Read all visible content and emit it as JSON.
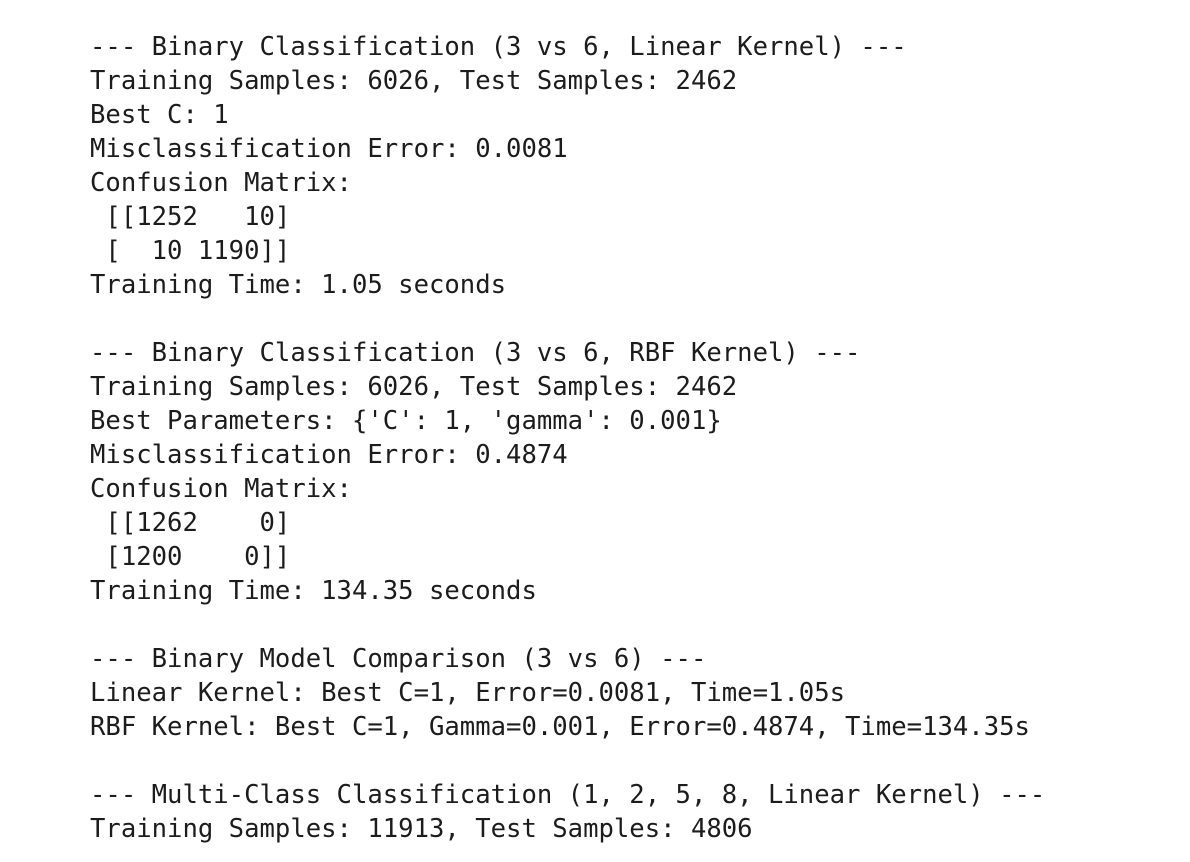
{
  "output": {
    "lines": [
      "--- Binary Classification (3 vs 6, Linear Kernel) ---",
      "Training Samples: 6026, Test Samples: 2462",
      "Best C: 1",
      "Misclassification Error: 0.0081",
      "Confusion Matrix:",
      " [[1252   10]",
      " [  10 1190]]",
      "Training Time: 1.05 seconds",
      "",
      "--- Binary Classification (3 vs 6, RBF Kernel) ---",
      "Training Samples: 6026, Test Samples: 2462",
      "Best Parameters: {'C': 1, 'gamma': 0.001}",
      "Misclassification Error: 0.4874",
      "Confusion Matrix:",
      " [[1262    0]",
      " [1200    0]]",
      "Training Time: 134.35 seconds",
      "",
      "--- Binary Model Comparison (3 vs 6) ---",
      "Linear Kernel: Best C=1, Error=0.0081, Time=1.05s",
      "RBF Kernel: Best C=1, Gamma=0.001, Error=0.4874, Time=134.35s",
      "",
      "--- Multi-Class Classification (1, 2, 5, 8, Linear Kernel) ---",
      "Training Samples: 11913, Test Samples: 4806"
    ]
  }
}
